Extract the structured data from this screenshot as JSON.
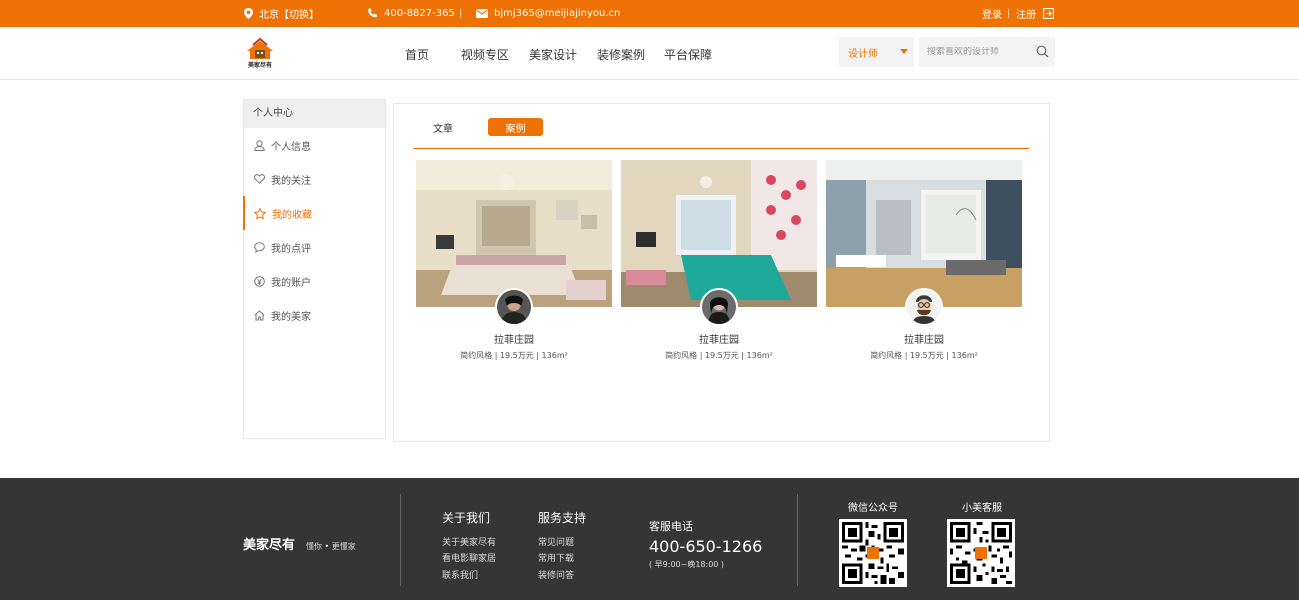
{
  "topbar": {
    "location": "北京【切换】",
    "phone": "400-8827-365",
    "separator": "|",
    "email": "bjmj365@meijiajinyou.cn",
    "login": "登录",
    "divider": "|",
    "register": "注册"
  },
  "header": {
    "nav": [
      "首页",
      "视频专区",
      "美家设计",
      "装修案例",
      "平台保障"
    ],
    "search_select": "设计师",
    "search_placeholder": "搜索喜欢的设计师"
  },
  "sidebar": {
    "title": "个人中心",
    "items": [
      {
        "label": "个人信息",
        "icon": "user-icon"
      },
      {
        "label": "我的关注",
        "icon": "heart-icon"
      },
      {
        "label": "我的收藏",
        "icon": "star-icon",
        "active": true
      },
      {
        "label": "我的点评",
        "icon": "comment-icon"
      },
      {
        "label": "我的账户",
        "icon": "yen-icon"
      },
      {
        "label": "我的美家",
        "icon": "home-icon"
      }
    ]
  },
  "tabs": {
    "article": "文章",
    "case": "案例"
  },
  "cards": [
    {
      "title": "拉菲庄园",
      "meta": "简约风格 | 19.5万元 | 136m²"
    },
    {
      "title": "拉菲庄园",
      "meta": "简约风格 | 19.5万元 | 136m²"
    },
    {
      "title": "拉菲庄园",
      "meta": "简约风格 | 19.5万元 | 136m²"
    }
  ],
  "footer": {
    "slogan": "懂你 • 更懂家",
    "about_title": "关于我们",
    "about_links": [
      "关于美家尽有",
      "看电影聊家居",
      "联系我们"
    ],
    "support_title": "服务支持",
    "support_links": [
      "常见问题",
      "常用下载",
      "装修问答"
    ],
    "phone_label": "客服电话",
    "phone": "400-650-1266",
    "hours": "( 早9:00~晚18:00 )",
    "wechat_label": "微信公众号",
    "service_label": "小美客服"
  },
  "colors": {
    "brand": "#ee7203",
    "footer_bg": "#353535"
  }
}
